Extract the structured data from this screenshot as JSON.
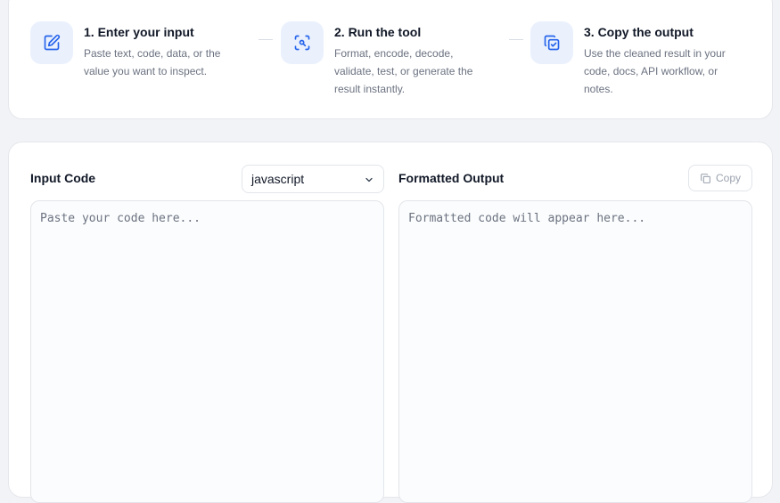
{
  "steps": [
    {
      "title": "1. Enter your input",
      "desc_line1": "Paste text, code, data, or the",
      "desc_line2": "value you want to inspect.",
      "desc_line3": "",
      "icon": "edit-icon"
    },
    {
      "title": "2. Run the tool",
      "desc_line1": "Format, encode, decode,",
      "desc_line2": "validate, test, or generate the",
      "desc_line3": "result instantly.",
      "icon": "scan-search-icon"
    },
    {
      "title": "3. Copy the output",
      "desc_line1": "Use the cleaned result in your",
      "desc_line2": "code, docs, API workflow, or",
      "desc_line3": "notes.",
      "icon": "copy-check-icon"
    }
  ],
  "input_panel": {
    "label": "Input Code",
    "language_selected": "javascript",
    "placeholder": "Paste your code here..."
  },
  "output_panel": {
    "label": "Formatted Output",
    "copy_label": "Copy",
    "placeholder": "Formatted code will appear here..."
  },
  "colors": {
    "accent": "#2563eb",
    "icon_bg": "#eaf1fd",
    "muted_text": "#6b7280",
    "border": "#e5e7eb"
  }
}
